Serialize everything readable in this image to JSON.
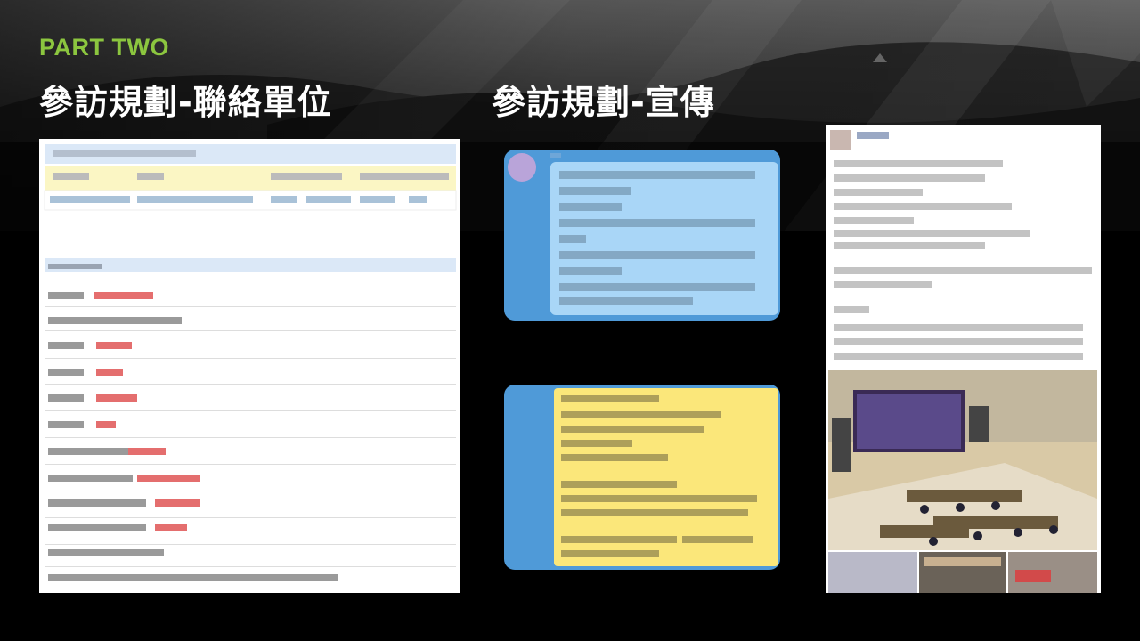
{
  "slide": {
    "part_label": "PART TWO",
    "left_title": "參訪規劃-聯絡單位",
    "right_title": "參訪規劃-宣傳"
  },
  "panels": {
    "contact_form": {
      "content": "blurred",
      "highlight_color": "#fbf6c4",
      "header_color": "#dbe8f7",
      "value_color": "#e05555"
    },
    "message_blue": {
      "content": "blurred",
      "bubble_color": "#a9d6f7",
      "frame_color": "#4f9ad8"
    },
    "message_yellow": {
      "content": "blurred",
      "bubble_color": "#fbe77a",
      "frame_color": "#4f9ad8"
    },
    "social_post": {
      "content": "blurred",
      "photo": "control-room"
    }
  },
  "colors": {
    "accent": "#8cc63f",
    "background": "#000000",
    "title": "#ffffff"
  }
}
